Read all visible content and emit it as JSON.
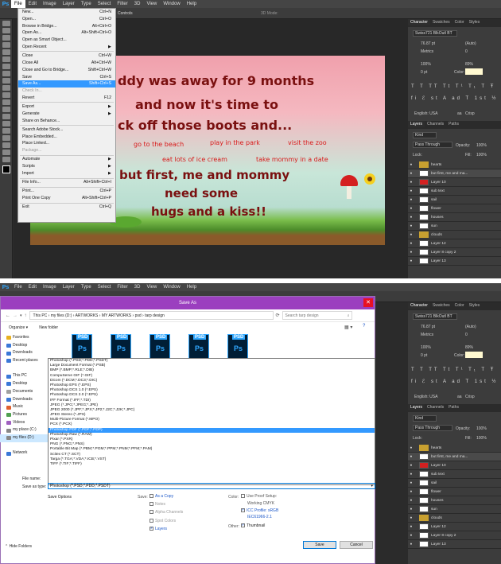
{
  "top": {
    "menubar": {
      "logo": "Ps",
      "items": [
        "File",
        "Edit",
        "Image",
        "Layer",
        "Type",
        "Select",
        "Filter",
        "3D",
        "View",
        "Window",
        "Help"
      ]
    },
    "options_bar": {
      "controls_label": "Controls",
      "mode_3d": "3D Mode:"
    },
    "file_menu": [
      {
        "label": "New...",
        "shortcut": "Ctrl+N"
      },
      {
        "label": "Open...",
        "shortcut": "Ctrl+O"
      },
      {
        "label": "Browse in Bridge...",
        "shortcut": "Alt+Ctrl+O"
      },
      {
        "label": "Open As...",
        "shortcut": "Alt+Shift+Ctrl+O"
      },
      {
        "label": "Open as Smart Object...",
        "shortcut": ""
      },
      {
        "label": "Open Recent",
        "shortcut": "▶"
      },
      {
        "sep": true
      },
      {
        "label": "Close",
        "shortcut": "Ctrl+W"
      },
      {
        "label": "Close All",
        "shortcut": "Alt+Ctrl+W"
      },
      {
        "label": "Close and Go to Bridge...",
        "shortcut": "Shift+Ctrl+W"
      },
      {
        "label": "Save",
        "shortcut": "Ctrl+S"
      },
      {
        "label": "Save As...",
        "shortcut": "Shift+Ctrl+S",
        "highlight": true
      },
      {
        "label": "Check In...",
        "shortcut": "",
        "disabled": true
      },
      {
        "label": "Revert",
        "shortcut": "F12"
      },
      {
        "sep": true
      },
      {
        "label": "Export",
        "shortcut": "▶"
      },
      {
        "label": "Generate",
        "shortcut": "▶"
      },
      {
        "label": "Share on Behance...",
        "shortcut": ""
      },
      {
        "sep": true
      },
      {
        "label": "Search Adobe Stock...",
        "shortcut": ""
      },
      {
        "label": "Place Embedded...",
        "shortcut": ""
      },
      {
        "label": "Place Linked...",
        "shortcut": ""
      },
      {
        "label": "Package...",
        "shortcut": "",
        "disabled": true
      },
      {
        "sep": true
      },
      {
        "label": "Automate",
        "shortcut": "▶"
      },
      {
        "label": "Scripts",
        "shortcut": "▶"
      },
      {
        "label": "Import",
        "shortcut": "▶"
      },
      {
        "sep": true
      },
      {
        "label": "File Info...",
        "shortcut": "Alt+Shift+Ctrl+I"
      },
      {
        "sep": true
      },
      {
        "label": "Print...",
        "shortcut": "Ctrl+P"
      },
      {
        "label": "Print One Copy",
        "shortcut": "Alt+Shift+Ctrl+P"
      },
      {
        "sep": true
      },
      {
        "label": "Exit",
        "shortcut": "Ctrl+Q"
      }
    ],
    "canvas": {
      "line1": "ddy was away for 9 months",
      "line2": "and now it's time to",
      "line3": "ck off those boots and...",
      "pink1": "go to the beach",
      "pink2": "play in the park",
      "pink3": "visit the zoo",
      "pink4": "eat lots of ice cream",
      "pink5": "take mommy in a date",
      "line4": "but first, me and mommy",
      "line5": "need some",
      "line6": "hugs and a kiss!!"
    },
    "character": {
      "tabs": [
        "Character",
        "Swatches",
        "Color",
        "Styles"
      ],
      "font": "Swiss721 BlkOutl BT",
      "size": "76.87 pt",
      "leading": "(Auto)",
      "kerning": "Metrics",
      "tracking": "0",
      "scale_v": "100%",
      "scale_h": "89%",
      "baseline": "0 pt",
      "color_label": "Color:",
      "lang": "English: USA",
      "aa": "aa",
      "aa_mode": "Crisp"
    },
    "layers": {
      "tabs": [
        "Layers",
        "Channels",
        "Paths"
      ],
      "kind": "Kind",
      "blend": "Pass Through",
      "opacity_label": "Opacity:",
      "opacity": "100%",
      "lock_label": "Lock:",
      "fill_label": "Fill:",
      "fill": "100%",
      "rows": [
        "hearts",
        "but first, me and ma...",
        "Layer 10",
        "sub text",
        "sail",
        "flower",
        "houses",
        "sun",
        "clouds",
        "Layer 12",
        "Layer 8 copy 2",
        "Layer 13"
      ]
    }
  },
  "dialog": {
    "title": "Save As",
    "breadcrumb": [
      "This PC",
      "my files (D:)",
      "ARTWORKS",
      "MY ARTWORKS",
      "psd",
      "tarp design"
    ],
    "search_placeholder": "Search tarp design",
    "organize": "Organize ▾",
    "new_folder": "New folder",
    "nav": [
      "Favorites",
      "Desktop",
      "Downloads",
      "Recent places",
      "",
      "This PC",
      "Desktop",
      "Documents",
      "Downloads",
      "Music",
      "Pictures",
      "Videos",
      "my place (C:)",
      "my files (D:)",
      "",
      "Network"
    ],
    "file_thumb_label": "PSD",
    "file_thumb_ps": "Ps",
    "format_options": [
      "Photoshop (*.PSD;*.PDD;*.PSDT)",
      "Large Document Format (*.PSB)",
      "BMP (*.BMP;*.RLE;*.DIB)",
      "CompuServe GIF (*.GIF)",
      "Dicom (*.DCM;*.DC3;*.DIC)",
      "Photoshop EPS (*.EPS)",
      "Photoshop DCS 1.0 (*.EPS)",
      "Photoshop DCS 2.0 (*.EPS)",
      "IFF Format (*.IFF;*.TDI)",
      "JPEG (*.JPG;*.JPEG;*.JPE)",
      "JPEG 2000 (*.JPF;*.JPX;*.JP2;*.J2C;*.J2K;*.JPC)",
      "JPEG Stereo (*.JPS)",
      "Multi-Picture Format (*.MPO)",
      "PCX (*.PCX)",
      "Photoshop PDF (*.PDF;*.PDP)",
      "Photoshop Raw (*.RAW)",
      "Pixar (*.PXR)",
      "PNG (*.PNG;*.PNS)",
      "Portable Bit Map (*.PBM;*.PGM;*.PPM;*.PNM;*.PFM;*.PAM)",
      "Scitex CT (*.SCT)",
      "Targa (*.TGA;*.VDA;*.ICB;*.VST)",
      "TIFF (*.TIF;*.TIFF)"
    ],
    "highlighted_index": 14,
    "file_name_label": "File name:",
    "save_as_type_label": "Save as type:",
    "save_as_type_value": "Photoshop (*.PSD;*.PDD;*.PSDT)",
    "save_options": "Save Options",
    "save_label": "Save:",
    "as_copy": "As a Copy",
    "notes": "Notes",
    "alpha": "Alpha Channels",
    "spot": "Spot Colors",
    "layers": "Layers",
    "color_label": "Color:",
    "proof": "Use Proof Setup:",
    "proof_val": "Working CMYK",
    "icc": "ICC Profile: sRGB",
    "icc2": "IEC61966-2.1",
    "other_label": "Other:",
    "thumbnail": "Thumbnail",
    "hide_folders": "Hide Folders",
    "save_btn": "Save",
    "cancel_btn": "Cancel"
  }
}
